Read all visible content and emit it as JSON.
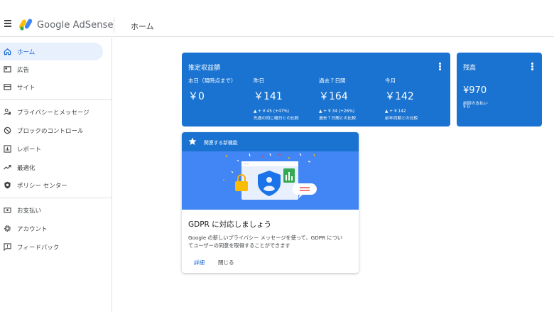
{
  "header": {
    "brand": "Google AdSense",
    "page_title": "ホーム"
  },
  "sidebar": {
    "items": [
      {
        "label": "ホーム",
        "icon": "home-icon",
        "active": true
      },
      {
        "label": "広告",
        "icon": "ads-icon"
      },
      {
        "label": "サイト",
        "icon": "sites-icon"
      },
      {
        "label": "プライバシーとメッセージ",
        "icon": "privacy-icon"
      },
      {
        "label": "ブロックのコントロール",
        "icon": "block-icon"
      },
      {
        "label": "レポート",
        "icon": "reports-icon"
      },
      {
        "label": "最適化",
        "icon": "optimization-icon"
      },
      {
        "label": "ポリシー センター",
        "icon": "policy-icon"
      },
      {
        "label": "お支払い",
        "icon": "payments-icon"
      },
      {
        "label": "アカウント",
        "icon": "gear-icon"
      },
      {
        "label": "フィードバック",
        "icon": "feedback-icon"
      }
    ]
  },
  "earnings": {
    "title": "推定収益額",
    "metrics": [
      {
        "label": "本日（現時点まで）",
        "value": "￥0",
        "delta": "",
        "compare": ""
      },
      {
        "label": "昨日",
        "value": "￥141",
        "delta": "▲ + ¥ 45 (+47%)",
        "compare": "先週の同じ曜日との比較"
      },
      {
        "label": "過去７日間",
        "value": "￥164",
        "delta": "▲ + ¥ 34 (+26%)",
        "compare": "過去７日間との比較"
      },
      {
        "label": "今月",
        "value": "￥142",
        "delta": "▲ + ¥ 142",
        "compare": "前年同期との比較"
      }
    ]
  },
  "balance": {
    "title": "残高",
    "value": "¥970",
    "last_payment_label": "前回の支払い",
    "last_payment_value": "¥ 0"
  },
  "feature": {
    "header": "関連する新機能",
    "heading": "GDPR に対応しましょう",
    "body_line1": "Google の新しいプライバシー メッセージを使って、GDPR につい",
    "body_line2": "てユーザーの同意を取得することができます",
    "details_label": "詳細",
    "close_label": "閉じる"
  },
  "colors": {
    "card_blue": "#1a73d1",
    "illustration_blue": "#4285f4",
    "active_nav_bg": "#e8f0fe",
    "link_blue": "#1967d2"
  }
}
